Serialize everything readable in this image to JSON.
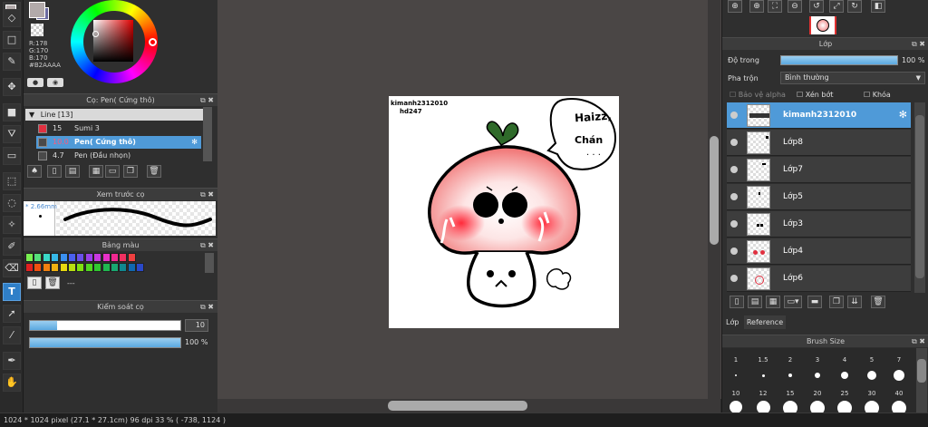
{
  "color": {
    "r": "R:178",
    "g": "G:170",
    "b": "B:170",
    "hex": "#B2AAAA",
    "main": "#b2aaaa",
    "secondary": "#6a6aa0"
  },
  "brush_panel": {
    "title": "Cọ: Pen( Cứng thô)",
    "group": "Line [13]",
    "items": [
      {
        "size": "15",
        "name": "Sumi 3",
        "swatch": "#e03040"
      },
      {
        "size": "10.0",
        "name": "Pen( Cứng thô)",
        "swatch": "#4a4a4a"
      },
      {
        "size": "4.7",
        "name": "Pen (Đầu nhọn)",
        "swatch": "#4a4a4a"
      }
    ]
  },
  "preview_panel": {
    "title": "Xem trước cọ",
    "size": "* 2.66mm"
  },
  "palette_panel": {
    "title": "Bảng màu",
    "more": "---",
    "row1": [
      "#79f050",
      "#55e07a",
      "#3ad8c8",
      "#36b8e8",
      "#3a90f0",
      "#4a60f0",
      "#6a50e8",
      "#9a40e8",
      "#c838e0",
      "#e830c8",
      "#f02890",
      "#f03060",
      "#f04040"
    ],
    "row2": [
      "#e02020",
      "#f05010",
      "#f08010",
      "#f0b010",
      "#e8d810",
      "#b8e010",
      "#80e010",
      "#50d820",
      "#30c830",
      "#20b850",
      "#18a870",
      "#108890",
      "#1068b0",
      "#2a48c8"
    ]
  },
  "control_panel": {
    "title": "Kiểm soát cọ",
    "size_value": "10",
    "opacity_value": "100 %",
    "size_fraction": 0.18,
    "opacity_fraction": 1.0
  },
  "layer_panel": {
    "title": "Lớp",
    "opacity_label": "Độ trong",
    "opacity_value": "100 %",
    "blend_label": "Pha trộn",
    "blend_value": "Bình thường",
    "protect_alpha": "Bảo vệ alpha",
    "clipping": "Xén bớt",
    "lock": "Khóa",
    "layers": [
      {
        "name": "kimanh2312010",
        "selected": true
      },
      {
        "name": "Lớp8",
        "selected": false
      },
      {
        "name": "Lớp7",
        "selected": false
      },
      {
        "name": "Lớp5",
        "selected": false
      },
      {
        "name": "Lớp3",
        "selected": false
      },
      {
        "name": "Lớp4",
        "selected": false
      },
      {
        "name": "Lớp6",
        "selected": false
      }
    ],
    "tabs": [
      "Lớp",
      "Reference"
    ]
  },
  "brush_size_panel": {
    "title": "Brush Size",
    "row1": [
      "1",
      "1.5",
      "2",
      "3",
      "4",
      "5",
      "7"
    ],
    "row2": [
      "10",
      "12",
      "15",
      "20",
      "25",
      "30",
      "40"
    ]
  },
  "canvas": {
    "signature_line1": "kimanh2312010",
    "signature_line2": "hd247",
    "bubble_line1": "Haizz,",
    "bubble_line2": "Chán",
    "bubble_dots": "· · ·"
  },
  "status": {
    "text": "1024 * 1024 pixel   (27.1 * 27.1cm)   96 dpi   33 %   ( -738, 1124 )"
  }
}
